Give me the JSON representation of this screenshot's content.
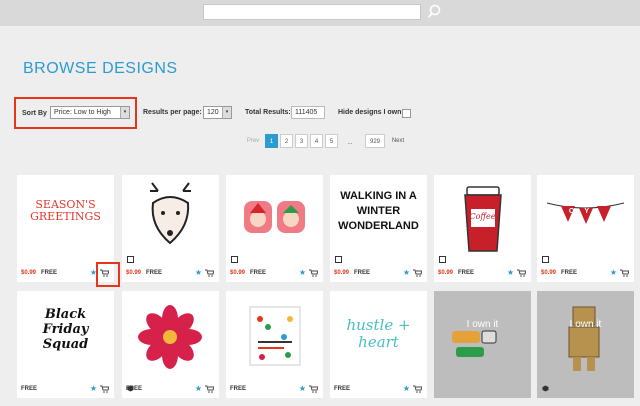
{
  "search": {
    "value": "",
    "placeholder": ""
  },
  "page_title": "BROWSE DESIGNS",
  "controls": {
    "sort_label": "Sort By",
    "sort_value": "Price: Low to High",
    "per_page_label": "Results per page:",
    "per_page_value": "120",
    "total_label": "Total Results:",
    "total_value": "111405",
    "hide_owned_label": "Hide designs I own",
    "hide_owned_checked": false
  },
  "pagination": {
    "prev": "Prev",
    "pages": [
      "1",
      "2",
      "3",
      "4",
      "5"
    ],
    "current": "1",
    "ellipsis": "...",
    "last": "929",
    "next": "Next"
  },
  "designs": [
    {
      "art_text": "SEASON'S GREETINGS",
      "price": "$0.99",
      "free": "FREE",
      "own": ""
    },
    {
      "art_text": "",
      "price": "$0.99",
      "free": "FREE",
      "own": ""
    },
    {
      "art_text": "",
      "price": "$0.99",
      "free": "FREE",
      "own": ""
    },
    {
      "art_text": "WALKING IN A WINTER WONDERLAND",
      "price": "$0.99",
      "free": "FREE",
      "own": ""
    },
    {
      "art_text": "Coffee",
      "price": "$0.99",
      "free": "FREE",
      "own": ""
    },
    {
      "art_text": "JOY",
      "price": "$0.99",
      "free": "FREE",
      "own": ""
    },
    {
      "art_text": "Black Friday Squad",
      "price": "",
      "free": "FREE",
      "own": ""
    },
    {
      "art_text": "",
      "price": "",
      "free": "FREE",
      "own": ""
    },
    {
      "art_text": "",
      "price": "",
      "free": "FREE",
      "own": ""
    },
    {
      "art_text": "hustle + heart",
      "price": "",
      "free": "FREE",
      "own": ""
    },
    {
      "art_text": "",
      "price": "",
      "free": "",
      "own": "I own it"
    },
    {
      "art_text": "",
      "price": "",
      "free": "",
      "own": "I own it"
    }
  ],
  "colors": {
    "accent": "#2c9bcf",
    "price": "#e5361c",
    "highlight": "#e5361c"
  }
}
